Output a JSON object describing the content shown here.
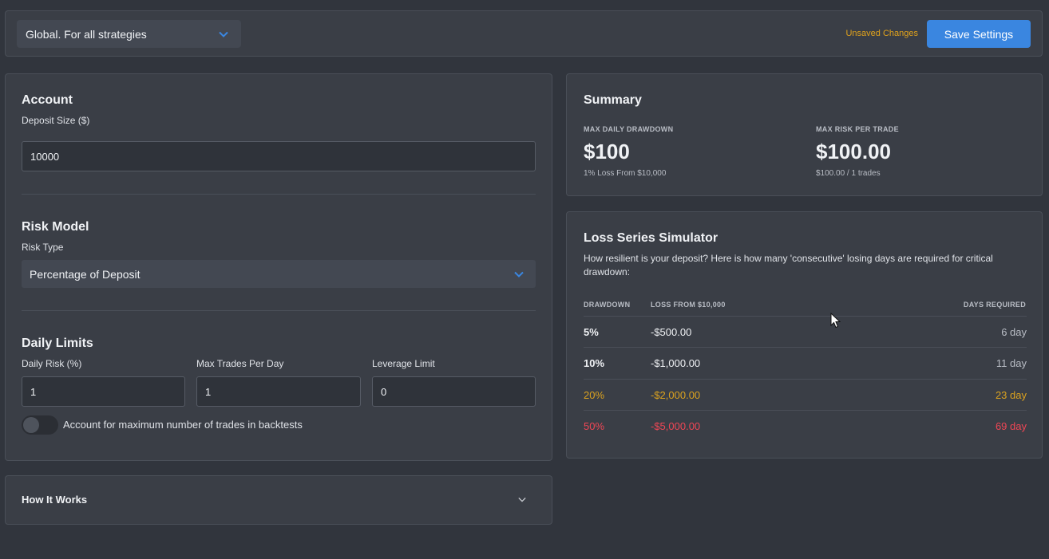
{
  "topbar": {
    "strategy_select": "Global. For all strategies",
    "unsaved_text": "Unsaved Changes",
    "save_label": "Save Settings"
  },
  "account": {
    "title": "Account",
    "deposit_label": "Deposit Size ($)",
    "deposit_value": "10000"
  },
  "risk_model": {
    "title": "Risk Model",
    "risk_type_label": "Risk Type",
    "risk_type_value": "Percentage of Deposit"
  },
  "daily_limits": {
    "title": "Daily Limits",
    "daily_risk_label": "Daily Risk (%)",
    "daily_risk_value": "1",
    "max_trades_label": "Max Trades Per Day",
    "max_trades_value": "1",
    "leverage_label": "Leverage Limit",
    "leverage_value": "0",
    "toggle_label": "Account for maximum number of trades in backtests",
    "toggle_on": false
  },
  "how_it_works": {
    "title": "How It Works"
  },
  "summary": {
    "title": "Summary",
    "max_daily_label": "MAX DAILY DRAWDOWN",
    "max_daily_value": "$100",
    "max_daily_sub": "1% Loss From $10,000",
    "max_risk_label": "MAX RISK PER TRADE",
    "max_risk_value": "$100.00",
    "max_risk_sub": "$100.00 / 1 trades"
  },
  "simulator": {
    "title": "Loss Series Simulator",
    "description": "How resilient is your deposit? Here is how many 'consecutive' losing days are required for critical drawdown:",
    "headers": {
      "drawdown": "DRAWDOWN",
      "loss": "LOSS FROM $10,000",
      "days": "DAYS REQUIRED"
    },
    "rows": [
      {
        "drawdown": "5%",
        "loss": "-$500.00",
        "days": "6 day"
      },
      {
        "drawdown": "10%",
        "loss": "-$1,000.00",
        "days": "11 day"
      },
      {
        "drawdown": "20%",
        "loss": "-$2,000.00",
        "days": "23 day"
      },
      {
        "drawdown": "50%",
        "loss": "-$5,000.00",
        "days": "69 day"
      }
    ]
  },
  "colors": {
    "accent": "#3a86e0",
    "warning": "#dba21f",
    "danger": "#f04655"
  }
}
